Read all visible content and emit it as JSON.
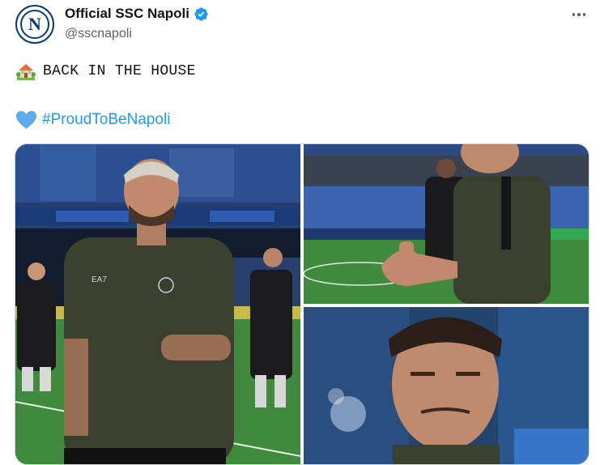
{
  "author": {
    "display_name": "Official SSC Napoli",
    "handle": "@sscnapoli",
    "avatar_letter": "N",
    "verified": true
  },
  "tweet": {
    "line1_emoji": "house-with-garden-emoji",
    "line1_text": "BACK IN THE HOUSE",
    "line2_emoji": "blue-heart-emoji",
    "hashtag": "#ProudToBeNapoli"
  },
  "media": {
    "count": 3
  },
  "colors": {
    "link": "#1d9bf0",
    "verified": "#1d9bf0",
    "text": "#0f1419",
    "muted": "#536471",
    "napoli_blue": "#0a3a75",
    "jersey_olive": "#3a3f2e",
    "pitch_green": "#3f8a3c"
  }
}
